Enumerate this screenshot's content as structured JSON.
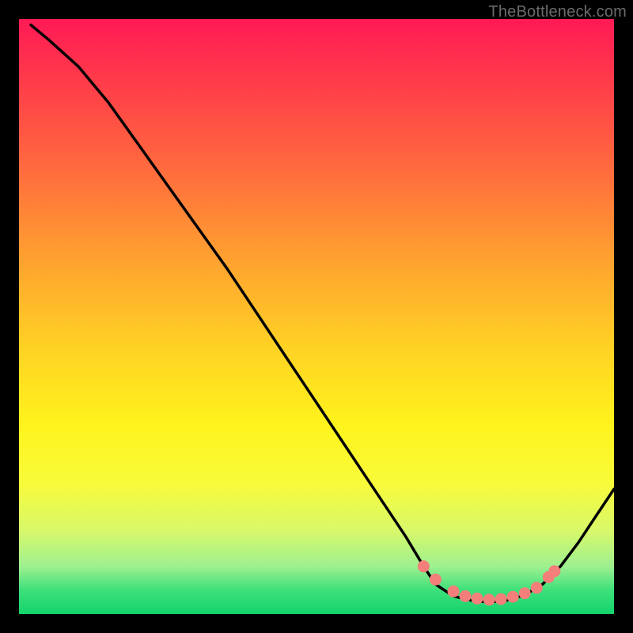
{
  "watermark": "TheBottleneck.com",
  "chart_data": {
    "type": "line",
    "title": "",
    "xlabel": "",
    "ylabel": "",
    "xlim": [
      0,
      100
    ],
    "ylim": [
      0,
      100
    ],
    "grid": false,
    "legend": false,
    "curve": [
      {
        "x": 2,
        "y": 99
      },
      {
        "x": 5,
        "y": 96.5
      },
      {
        "x": 10,
        "y": 92
      },
      {
        "x": 15,
        "y": 86
      },
      {
        "x": 20,
        "y": 79
      },
      {
        "x": 25,
        "y": 72
      },
      {
        "x": 30,
        "y": 65
      },
      {
        "x": 35,
        "y": 58
      },
      {
        "x": 40,
        "y": 50.5
      },
      {
        "x": 45,
        "y": 43
      },
      {
        "x": 50,
        "y": 35.5
      },
      {
        "x": 55,
        "y": 28
      },
      {
        "x": 60,
        "y": 20.5
      },
      {
        "x": 65,
        "y": 13
      },
      {
        "x": 68,
        "y": 8
      },
      {
        "x": 70,
        "y": 5
      },
      {
        "x": 73,
        "y": 3
      },
      {
        "x": 76,
        "y": 2.3
      },
      {
        "x": 79,
        "y": 2
      },
      {
        "x": 82,
        "y": 2.3
      },
      {
        "x": 85,
        "y": 3.2
      },
      {
        "x": 88,
        "y": 5
      },
      {
        "x": 91,
        "y": 8
      },
      {
        "x": 94,
        "y": 12
      },
      {
        "x": 97,
        "y": 16.5
      },
      {
        "x": 100,
        "y": 21
      }
    ],
    "markers": [
      {
        "x": 68,
        "y": 8
      },
      {
        "x": 70,
        "y": 5.8
      },
      {
        "x": 73,
        "y": 3.8
      },
      {
        "x": 75,
        "y": 3.0
      },
      {
        "x": 77,
        "y": 2.6
      },
      {
        "x": 79,
        "y": 2.4
      },
      {
        "x": 81,
        "y": 2.5
      },
      {
        "x": 83,
        "y": 2.9
      },
      {
        "x": 85,
        "y": 3.5
      },
      {
        "x": 87,
        "y": 4.4
      },
      {
        "x": 89,
        "y": 6.2
      },
      {
        "x": 90,
        "y": 7.2
      }
    ],
    "gradient_colors": {
      "top": "#ff1a55",
      "mid": "#fff31c",
      "bottom": "#14d36a"
    },
    "marker_color": "#f47f7a",
    "line_color": "#000000"
  }
}
